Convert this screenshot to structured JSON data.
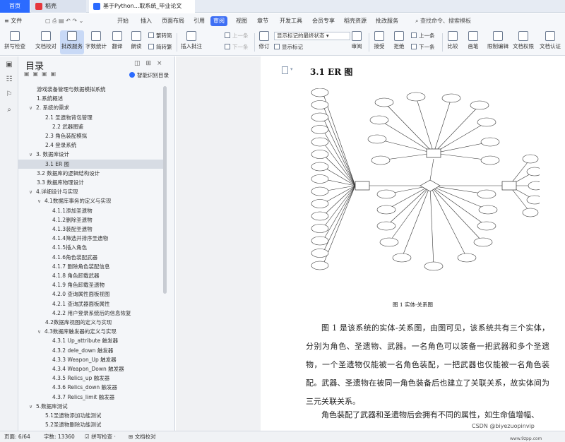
{
  "tabs": {
    "home": "首页",
    "wps": "稻壳",
    "doc": "基于Python...取系统_毕业论文"
  },
  "menu": {
    "items": [
      "文件",
      "开始",
      "插入",
      "页面布局",
      "引用",
      "审阅",
      "视图",
      "章节",
      "开发工具",
      "会员专享",
      "稻壳资源",
      "批改服务"
    ],
    "active": "审阅",
    "search": "查找命令、搜索模板"
  },
  "ribbon": {
    "big": [
      "拼写检查",
      "文档校对",
      "批改服务",
      "字数统计",
      "翻译",
      "朗读",
      "插入批注",
      "修订",
      "审阅",
      "接受",
      "拒绝",
      "比较",
      "限制编辑",
      "文档权限",
      "文档认证"
    ],
    "small": {
      "simp": "繁转简",
      "trad": "简转繁",
      "prev_comment": "上一条",
      "next_comment": "下一条",
      "show_markup": "显示标记",
      "review_state": "显示标记的最终状态",
      "prev_rev": "上一条",
      "next_rev": "下一条",
      "pen": "画笔"
    }
  },
  "nav": {
    "title": "目录",
    "smart": "智能识别目录",
    "toc": [
      {
        "text": "游戏装备管理与数据模拟系统",
        "lvl": 1,
        "tg": ""
      },
      {
        "text": "1.系统概述",
        "lvl": 1,
        "tg": ""
      },
      {
        "text": "2. 系统的需求",
        "lvl": 1,
        "tg": "∨"
      },
      {
        "text": "2.1 圣遗物背包管理",
        "lvl": 2,
        "tg": ""
      },
      {
        "text": "2.2 武器图鉴",
        "lvl": 3,
        "tg": ""
      },
      {
        "text": "2.3 角色装配模拟",
        "lvl": 2,
        "tg": ""
      },
      {
        "text": "2.4 登录系统",
        "lvl": 2,
        "tg": ""
      },
      {
        "text": "3. 数据库设计",
        "lvl": 1,
        "tg": "∨"
      },
      {
        "text": "3.1 ER 图",
        "lvl": 2,
        "tg": "",
        "cur": true
      },
      {
        "text": "3.2 数据库的逻辑结构设计",
        "lvl": 1,
        "tg": ""
      },
      {
        "text": "3.3 数据库物理设计",
        "lvl": 1,
        "tg": ""
      },
      {
        "text": "4.详细设计与实现",
        "lvl": 1,
        "tg": "∨"
      },
      {
        "text": "4.1数据库事务的定义与实现",
        "lvl": 2,
        "tg": "∨"
      },
      {
        "text": "4.1.1添加圣遗物",
        "lvl": 3,
        "tg": ""
      },
      {
        "text": "4.1.2删除圣遗物",
        "lvl": 3,
        "tg": ""
      },
      {
        "text": "4.1.3装配圣遗物",
        "lvl": 3,
        "tg": ""
      },
      {
        "text": "4.1.4筛选并排序圣遗物",
        "lvl": 3,
        "tg": ""
      },
      {
        "text": "4.1.5插入角色",
        "lvl": 3,
        "tg": ""
      },
      {
        "text": "4.1.6角色装配武器",
        "lvl": 3,
        "tg": ""
      },
      {
        "text": "4.1.7 删除角色装配信息",
        "lvl": 3,
        "tg": ""
      },
      {
        "text": "4.1.8 角色卸载武器",
        "lvl": 3,
        "tg": ""
      },
      {
        "text": "4.1.9 角色卸载圣遗物",
        "lvl": 3,
        "tg": ""
      },
      {
        "text": "4.2.0 查询属性面板视图",
        "lvl": 3,
        "tg": ""
      },
      {
        "text": "4.2.1 查询武器面板属性",
        "lvl": 3,
        "tg": ""
      },
      {
        "text": "4.2.2 用户登录系统后的信息恢复",
        "lvl": 3,
        "tg": ""
      },
      {
        "text": "4.2数据库视图的定义与实现",
        "lvl": 2,
        "tg": ""
      },
      {
        "text": "4.3数据库触发器的定义与实现",
        "lvl": 2,
        "tg": "∨"
      },
      {
        "text": "4.3.1 Up_attribute 触发器",
        "lvl": 3,
        "tg": ""
      },
      {
        "text": "4.3.2 dele_down 触发器",
        "lvl": 3,
        "tg": ""
      },
      {
        "text": "4.3.3 Weapon_Up 触发器",
        "lvl": 3,
        "tg": ""
      },
      {
        "text": "4.3.4 Weapon_Down 触发器",
        "lvl": 3,
        "tg": ""
      },
      {
        "text": "4.3.5 Relics_up 触发器",
        "lvl": 3,
        "tg": ""
      },
      {
        "text": "4.3.6 Relics_down 触发器",
        "lvl": 3,
        "tg": ""
      },
      {
        "text": "4.3.7 Relics_limit 触发器",
        "lvl": 3,
        "tg": ""
      },
      {
        "text": "5.数据库测试",
        "lvl": 1,
        "tg": "∨"
      },
      {
        "text": "5.1圣遗物添加功能测试",
        "lvl": 2,
        "tg": ""
      },
      {
        "text": "5.2圣遗物删除功能测试",
        "lvl": 2,
        "tg": ""
      }
    ]
  },
  "document": {
    "heading": "3.1 ER 图",
    "figure_caption": "图 1  实体-关系图",
    "para1": "图 1 是该系统的实体-关系图，由图可见，该系统共有三个实体，分别为角色、圣遗物、武器。一名角色可以装备一把武器和多个圣遗物，一个圣遗物仅能被一名角色装配，一把武器也仅能被一名角色装配。武器、圣遗物在被同一角色装备后也建立了关联关系，故实体间为三元关联关系。",
    "para2": "角色装配了武器和圣遗物后会拥有不同的属性，如生命值增幅、"
  },
  "status": {
    "page": "页面: 6/64",
    "words": "字数: 13360",
    "spell": "拼写检查 ·",
    "proof": "文档校对"
  },
  "watermark": "CSDN @biyezuopinvip",
  "watermark2": "www.9zpp.com"
}
